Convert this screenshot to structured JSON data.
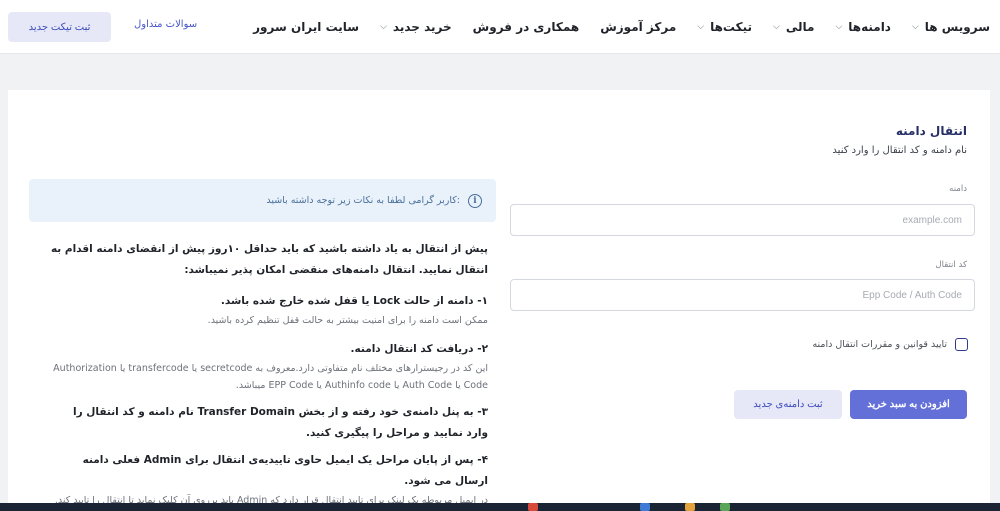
{
  "nav": {
    "items": [
      {
        "label": "سرویس ها",
        "dropdown": true
      },
      {
        "label": "دامنه‌ها",
        "dropdown": true
      },
      {
        "label": "مالی",
        "dropdown": true
      },
      {
        "label": "تیکت‌ها",
        "dropdown": true
      },
      {
        "label": "مرکز آموزش",
        "dropdown": false
      },
      {
        "label": "همکاری در فروش",
        "dropdown": false
      },
      {
        "label": "خرید جدید",
        "dropdown": true
      },
      {
        "label": "سایت ایران سرور",
        "dropdown": false
      }
    ],
    "faq_label": "سوالات متداول",
    "new_ticket_label": "ثبت تیکت جدید"
  },
  "form": {
    "title": "انتقال دامنه",
    "subtitle": "نام دامنه و کد انتقال را وارد کنید",
    "domain_label": "دامنه",
    "domain_placeholder": "example.com",
    "code_label": "کد انتقال",
    "code_placeholder": "Epp Code / Auth Code",
    "agree_label": "تایید قوانین و مقررات انتقال دامنه",
    "add_to_cart_label": "افزودن به سبد خرید",
    "register_new_label": "ثبت دامنه‌ی جدید"
  },
  "info": {
    "alert_text": "کاربر گرامی لطفا به نکات زیر توجه داشته باشید:",
    "intro": "پیش از انتقال به یاد داشته باشید که باید حداقل ۱۰روز پیش از انقضای دامنه اقدام به انتقال نمایید. انتقال دامنه‌های منقضی امکان پذیر نمیباشد:",
    "step1_title": "۱- دامنه از حالت Lock یا قفل شده خارج شده باشد.",
    "step1_desc": "ممکن است دامنه را برای امنیت بیشتر به حالت قفل تنظیم کرده باشید.",
    "step2_title": "۲- دریافت کد انتقال دامنه.",
    "step2_desc": "این کد در رجیسترارهای مختلف نام متفاوتی دارد.معروف به secretcode یا transfercode یا Authorization Code یا Auth Code یا Authinfo code یا EPP Code میباشد.",
    "step3_title": "۳- به پنل دامنه‌ی خود رفته و از بخش Transfer Domain نام دامنه و کد انتقال را وارد نمایید و مراحل را پیگیری کنید.",
    "step4_title": "۴- پس از پایان مراحل یک ایمیل حاوی تاییدیه‌ی انتقال برای Admin فعلی دامنه ارسال می شود.",
    "step4_desc": "در ایمیل مربوطه یک لینک برای تایید انتقال قرار دارد که Admin باید برروی آن کلیک نماید تا انتقال را تایید کند. مطابق قوانین جدید ICANN جهت تایید روند انتقال دامنه ابتدا یک ایمیل از سمت رجیسترار به ایمیل فعلی"
  },
  "colors": {
    "accent": "#6370d8",
    "accent_soft": "#e6e8f8",
    "info_bg": "#e9f2fb",
    "page_bg": "#f1f2f4"
  }
}
